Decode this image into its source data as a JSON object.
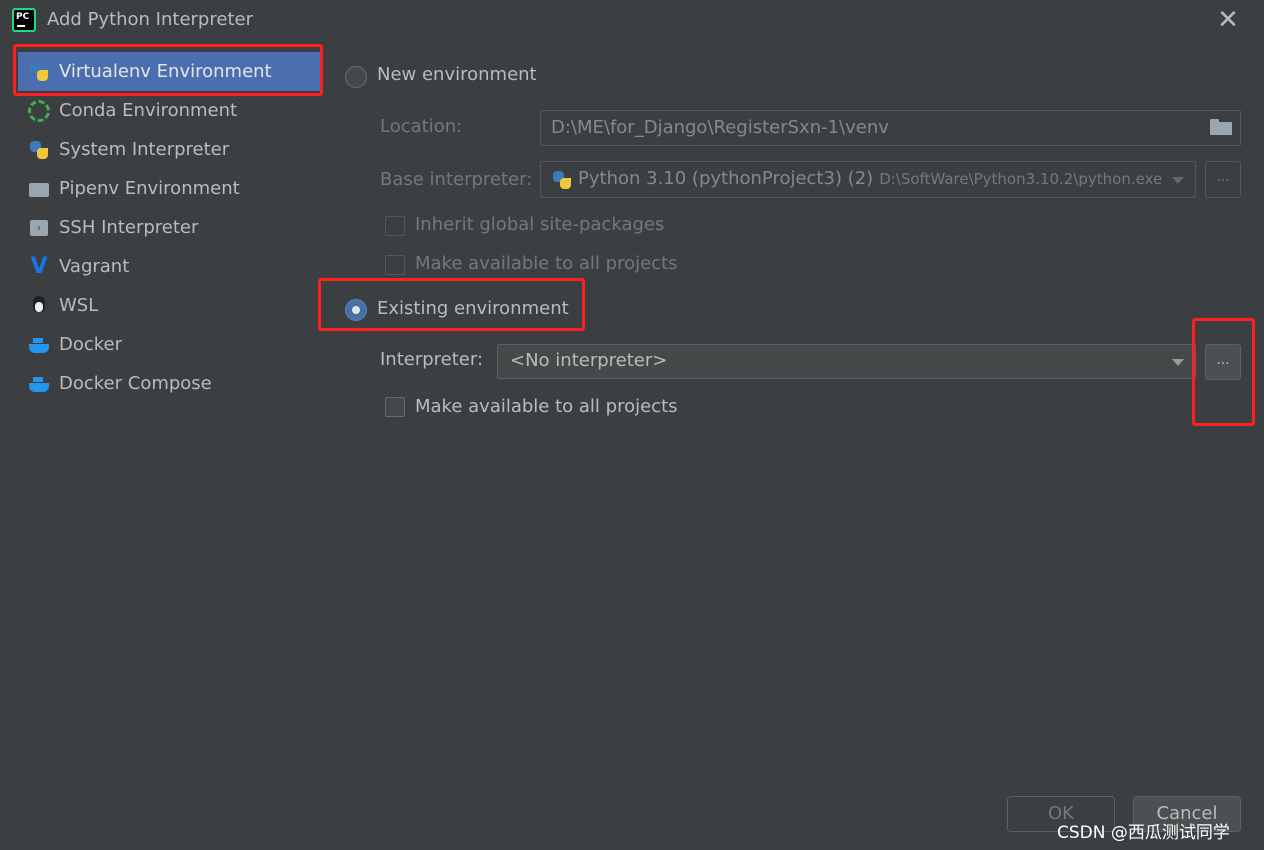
{
  "window": {
    "logo_text": "PC",
    "title": "Add Python Interpreter",
    "close_glyph": "✕"
  },
  "sidebar": {
    "items": [
      {
        "label": "Virtualenv Environment",
        "icon": "python-virtualenv-icon",
        "selected": true
      },
      {
        "label": "Conda Environment",
        "icon": "conda-icon"
      },
      {
        "label": "System Interpreter",
        "icon": "python-icon"
      },
      {
        "label": "Pipenv Environment",
        "icon": "pipenv-folder-icon"
      },
      {
        "label": "SSH Interpreter",
        "icon": "ssh-terminal-icon",
        "glyph": "›"
      },
      {
        "label": "Vagrant",
        "icon": "vagrant-icon",
        "glyph": "V"
      },
      {
        "label": "WSL",
        "icon": "linux-penguin-icon"
      },
      {
        "label": "Docker",
        "icon": "docker-whale-icon"
      },
      {
        "label": "Docker Compose",
        "icon": "docker-whale-icon"
      }
    ]
  },
  "new_env": {
    "radio_label": "New environment",
    "location_label": "Location:",
    "location_value": "D:\\ME\\for_Django\\RegisterSxn-1\\venv",
    "base_label": "Base interpreter:",
    "base_value": "Python 3.10 (pythonProject3) (2)",
    "base_path": "D:\\SoftWare\\Python3.10.2\\python.exe",
    "browse_label": "...",
    "inherit_label": "Inherit global site-packages",
    "make_available_label": "Make available to all projects"
  },
  "existing_env": {
    "radio_label": "Existing environment",
    "interpreter_label": "Interpreter:",
    "interpreter_value": "<No interpreter>",
    "browse_label": "...",
    "make_available_label": "Make available to all projects"
  },
  "footer": {
    "ok_label": "OK",
    "cancel_label": "Cancel"
  },
  "watermark": "CSDN @西瓜测试同学",
  "colors": {
    "background": "#3c3f41",
    "selection": "#4b6eaf",
    "highlight_box": "#ff1f1f"
  }
}
